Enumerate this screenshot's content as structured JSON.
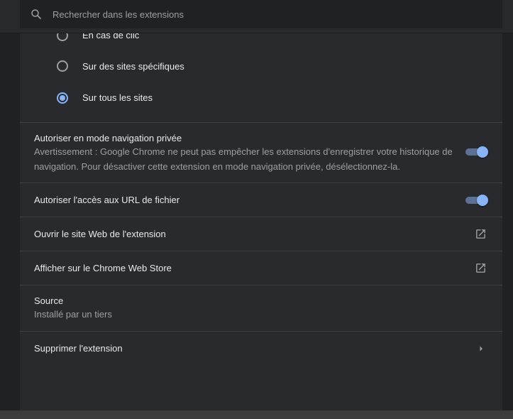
{
  "search": {
    "placeholder": "Rechercher dans les extensions"
  },
  "site_access": {
    "options": [
      {
        "label": "En cas de clic",
        "checked": false
      },
      {
        "label": "Sur des sites spécifiques",
        "checked": false
      },
      {
        "label": "Sur tous les sites",
        "checked": true
      }
    ]
  },
  "incognito": {
    "title": "Autoriser en mode navigation privée",
    "warning_line1": "Avertissement : Google Chrome ne peut pas empêcher les extensions d'enregistrer votre historique de",
    "warning_line2": "navigation. Pour désactiver cette extension en mode navigation privée, désélectionnez-la.",
    "enabled": true
  },
  "file_urls": {
    "title": "Autoriser l'accès aux URL de fichier",
    "enabled": true
  },
  "open_website": {
    "title": "Ouvrir le site Web de l'extension",
    "icon": "open-in-new-icon"
  },
  "web_store": {
    "title": "Afficher sur le Chrome Web Store",
    "icon": "open-in-new-icon"
  },
  "source": {
    "title": "Source",
    "value": "Installé par un tiers"
  },
  "remove": {
    "title": "Supprimer l'extension",
    "icon": "chevron-right-icon"
  },
  "colors": {
    "background": "#202124",
    "card": "#292a2d",
    "accent": "#8ab4f8",
    "text_primary": "#e8eaed",
    "text_secondary": "#9aa0a6"
  }
}
